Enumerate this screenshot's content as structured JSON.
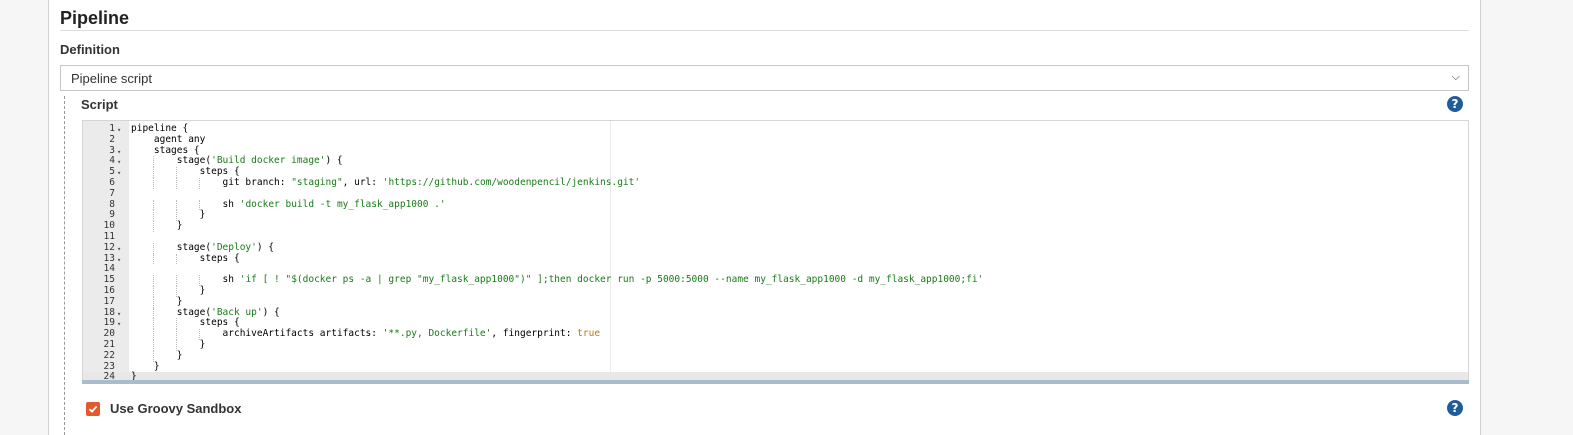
{
  "section": {
    "title": "Pipeline"
  },
  "definition": {
    "label": "Definition",
    "selected": "Pipeline script"
  },
  "script": {
    "label": "Script",
    "help_icon": "help-icon",
    "lines": [
      {
        "n": "1",
        "fold": true,
        "code": "pipeline {"
      },
      {
        "n": "2",
        "fold": false,
        "code": "    agent any"
      },
      {
        "n": "3",
        "fold": true,
        "code": "    stages {"
      },
      {
        "n": "4",
        "fold": true,
        "code": "        stage('Build docker image') {"
      },
      {
        "n": "5",
        "fold": true,
        "code": "            steps {"
      },
      {
        "n": "6",
        "fold": false,
        "code": "                git branch: \"staging\", url: 'https://github.com/woodenpencil/jenkins.git'"
      },
      {
        "n": "7",
        "fold": false,
        "code": ""
      },
      {
        "n": "8",
        "fold": false,
        "code": "                sh 'docker build -t my_flask_app1000 .'"
      },
      {
        "n": "9",
        "fold": false,
        "code": "            }"
      },
      {
        "n": "10",
        "fold": false,
        "code": "        }"
      },
      {
        "n": "11",
        "fold": false,
        "code": ""
      },
      {
        "n": "12",
        "fold": true,
        "code": "        stage('Deploy') {"
      },
      {
        "n": "13",
        "fold": true,
        "code": "            steps {"
      },
      {
        "n": "14",
        "fold": false,
        "code": ""
      },
      {
        "n": "15",
        "fold": false,
        "code": "                sh 'if [ ! \"$(docker ps -a | grep \"my_flask_app1000\")\" ];then docker run -p 5000:5000 --name my_flask_app1000 -d my_flask_app1000;fi'"
      },
      {
        "n": "16",
        "fold": false,
        "code": "            }"
      },
      {
        "n": "17",
        "fold": false,
        "code": "        }"
      },
      {
        "n": "18",
        "fold": true,
        "code": "        stage('Back up') {"
      },
      {
        "n": "19",
        "fold": true,
        "code": "            steps {"
      },
      {
        "n": "20",
        "fold": false,
        "code": "                archiveArtifacts artifacts: '**.py, Dockerfile', fingerprint: true"
      },
      {
        "n": "21",
        "fold": false,
        "code": "            }"
      },
      {
        "n": "22",
        "fold": false,
        "code": "        }"
      },
      {
        "n": "23",
        "fold": false,
        "code": "    }"
      },
      {
        "n": "24",
        "fold": false,
        "code": "}"
      }
    ]
  },
  "sandbox": {
    "label": "Use Groovy Sandbox",
    "checked": true,
    "help_icon": "help-icon"
  },
  "colors": {
    "checkbox": "#e4592c",
    "help": "#1f5d9a",
    "string": "#1a7a1a",
    "keyword": "#c9720c"
  }
}
